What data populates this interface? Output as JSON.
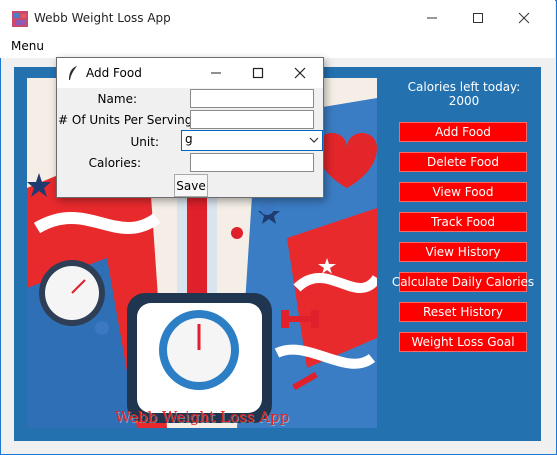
{
  "window": {
    "title": "Webb Weight Loss App",
    "menu": [
      "Menu"
    ]
  },
  "poster": {
    "caption": "Webb Weight Loss App"
  },
  "side_panel": {
    "calories_left": "Calories left today: 2000",
    "buttons": [
      "Add Food",
      "Delete Food",
      "View Food",
      "Track Food",
      "View History",
      "Calculate Daily Calories",
      "Reset History",
      "Weight Loss Goal"
    ]
  },
  "dialog": {
    "title": "Add Food",
    "fields": [
      {
        "label": "Name:",
        "value": ""
      },
      {
        "label": "# Of Units Per Serving:",
        "value": ""
      },
      {
        "label": "Unit:",
        "value": "g"
      },
      {
        "label": "Calories:",
        "value": ""
      }
    ],
    "save_label": "Save"
  },
  "colors": {
    "accent_button": "#ff0000",
    "content_background": "#2471b0"
  }
}
